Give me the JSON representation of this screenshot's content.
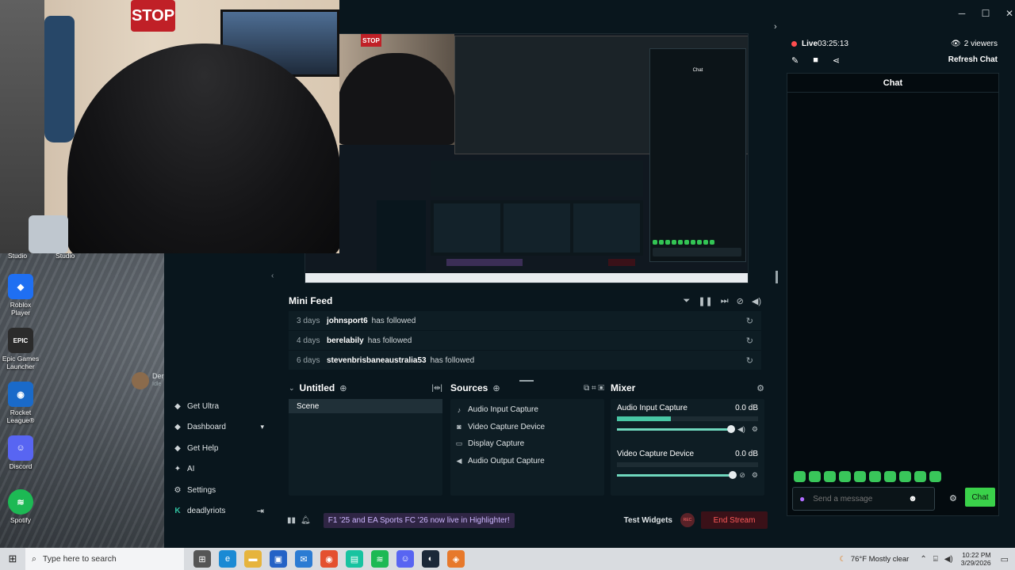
{
  "window_controls": [
    "─",
    "☐",
    "✕"
  ],
  "desktop": {
    "top_labels": [
      "Studio",
      "Studio"
    ],
    "icons": [
      {
        "label": "Roblox Player",
        "color": "#1f6ff2",
        "glyph": "◆"
      },
      {
        "label": "Epic Games Launcher",
        "color": "#2b2b2b",
        "glyph": "EPIC"
      },
      {
        "label": "Rocket League®",
        "color": "#1a6ac9",
        "glyph": "◉"
      },
      {
        "label": "Discord",
        "color": "#5865f2",
        "glyph": "☺"
      },
      {
        "label": "Spotify",
        "color": "#1db954",
        "glyph": "≋"
      }
    ]
  },
  "webcam": {
    "stop_sign": "STOP"
  },
  "preview": {
    "stop_sign": "STOP",
    "chat_title": "Chat"
  },
  "user": {
    "name": "Der",
    "status": "Idle"
  },
  "sidebar": {
    "items": [
      {
        "label": "Get Ultra",
        "icon": "ultra-icon",
        "glyph": "◆"
      },
      {
        "label": "Dashboard",
        "icon": "dashboard-icon",
        "glyph": "◆"
      },
      {
        "label": "Get Help",
        "icon": "help-icon",
        "glyph": "◆"
      },
      {
        "label": "AI",
        "icon": "ai-icon",
        "glyph": "✦"
      },
      {
        "label": "Settings",
        "icon": "gear-icon",
        "glyph": "⚙"
      }
    ],
    "user_label": "deadlyriots",
    "user_glyph": "K"
  },
  "mini_feed": {
    "title": "Mini Feed",
    "rows": [
      {
        "age": "3 days",
        "user": "johnsport6",
        "action": "has followed"
      },
      {
        "age": "4 days",
        "user": "berelabily",
        "action": "has followed"
      },
      {
        "age": "6 days",
        "user": "stevenbrisbaneaustralia53",
        "action": "has followed"
      }
    ]
  },
  "scenes": {
    "title": "Untitled",
    "items": [
      "Scene"
    ]
  },
  "sources": {
    "title": "Sources",
    "items": [
      {
        "label": "Audio Input Capture",
        "icon": "microphone-icon",
        "glyph": "♪"
      },
      {
        "label": "Video Capture Device",
        "icon": "camera-icon",
        "glyph": "◙"
      },
      {
        "label": "Display Capture",
        "icon": "monitor-icon",
        "glyph": "▭"
      },
      {
        "label": "Audio Output Capture",
        "icon": "speaker-icon",
        "glyph": "◀"
      }
    ]
  },
  "mixer": {
    "title": "Mixer",
    "channels": [
      {
        "name": "Audio Input Capture",
        "level": "0.0 dB",
        "meter_fill": 0.38,
        "volume": 1.0
      },
      {
        "name": "Video Capture Device",
        "level": "0.0 dB",
        "meter_fill": 0.0,
        "volume": 1.0
      }
    ]
  },
  "footer": {
    "banner": "F1 '25 and EA Sports FC '26 now live in Highlighter!",
    "test_widgets": "Test Widgets",
    "rec": "REC",
    "end_stream": "End Stream"
  },
  "chat_panel": {
    "live_label": "Live",
    "live_time": "03:25:13",
    "viewers": "2 viewers",
    "refresh": "Refresh Chat",
    "title": "Chat",
    "input_placeholder": "Send a message",
    "send_label": "Chat",
    "emote_count": 10
  },
  "taskbar": {
    "search_placeholder": "Type here to search",
    "apps": [
      {
        "name": "task-view",
        "color": "#555",
        "glyph": "⊞"
      },
      {
        "name": "edge",
        "color": "#1a8ad4",
        "glyph": "e"
      },
      {
        "name": "file-explorer",
        "color": "#e6b43c",
        "glyph": "▬"
      },
      {
        "name": "store",
        "color": "#2462c6",
        "glyph": "▣"
      },
      {
        "name": "outlook",
        "color": "#2b7bd3",
        "glyph": "✉"
      },
      {
        "name": "chrome",
        "color": "#e4502f",
        "glyph": "◉"
      },
      {
        "name": "streamlabs",
        "color": "#17c3a0",
        "glyph": "▤"
      },
      {
        "name": "spotify",
        "color": "#1db954",
        "glyph": "≋"
      },
      {
        "name": "discord",
        "color": "#5865f2",
        "glyph": "☺"
      },
      {
        "name": "steam",
        "color": "#1b2838",
        "glyph": "◐"
      },
      {
        "name": "app-orange",
        "color": "#e7792b",
        "glyph": "◈"
      }
    ],
    "weather": "76°F  Mostly clear",
    "time": "10:22 PM",
    "date": "3/29/2026"
  }
}
